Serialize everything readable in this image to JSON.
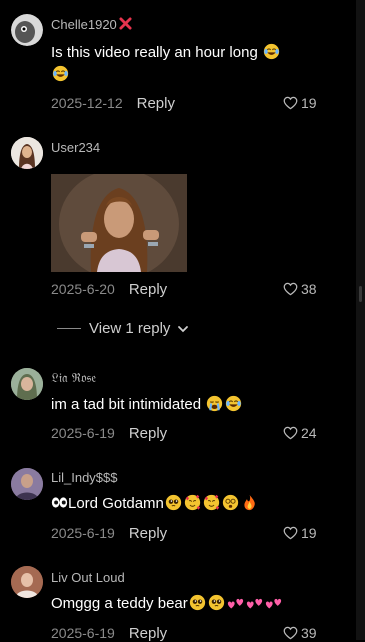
{
  "comments": [
    {
      "user": "Chelle1920",
      "user_emoji": "cross-mark",
      "text": "Is this video really an hour long",
      "date": "2025-12-12",
      "likes": "19"
    },
    {
      "user": "User234",
      "text": "",
      "has_image": true,
      "date": "2025-6-20",
      "likes": "38"
    },
    {
      "user": "𝔏𝔦𝔞 ℜ𝔬𝔰𝔢",
      "text": "im a tad bit intimidated",
      "date": "2025-6-19",
      "likes": "24"
    },
    {
      "user": "Lil_Indy$$$",
      "text": "Lord Gotdamn",
      "date": "2025-6-19",
      "likes": "19"
    },
    {
      "user": "Liv Out Loud",
      "text": "Omggg a teddy bear",
      "date": "2025-6-19",
      "likes": "39"
    }
  ],
  "reply_label": "Reply",
  "view_replies_label": "View 1 reply",
  "colors": {
    "background": "#000000",
    "muted": "#8a8a8a",
    "username": "#b9b9b9"
  }
}
